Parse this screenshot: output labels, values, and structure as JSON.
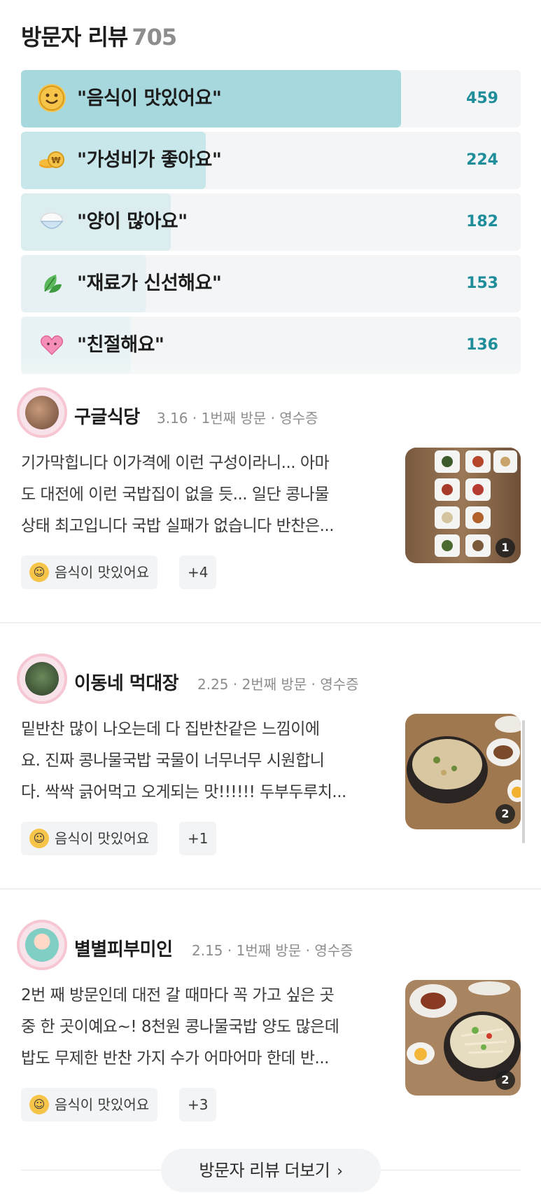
{
  "header": {
    "title": "방문자 리뷰",
    "count": "705"
  },
  "stats": [
    {
      "icon": "smiley-icon",
      "label": "\"음식이 맛있어요\"",
      "count": "459",
      "fraction": 0.76
    },
    {
      "icon": "coin-icon",
      "label": "\"가성비가 좋아요\"",
      "count": "224",
      "fraction": 0.37
    },
    {
      "icon": "rice-bowl-icon",
      "label": "\"양이 많아요\"",
      "count": "182",
      "fraction": 0.3
    },
    {
      "icon": "leaf-icon",
      "label": "\"재료가 신선해요\"",
      "count": "153",
      "fraction": 0.25
    },
    {
      "icon": "heart-icon",
      "label": "\"친절해요\"",
      "count": "136",
      "fraction": 0.22
    }
  ],
  "colors": {
    "accent": "#1f8d9a",
    "bar_fill": "#a6d8de"
  },
  "reviews": [
    {
      "name": "구글식당",
      "meta": "3.16 · 1번째 방문 · 영수증",
      "text_lines": [
        "기가막힙니다 이가격에 이런 구성이라니... 아마",
        "도 대전에 이런 국밥집이 없을 듯... 일단 콩나물",
        "상태 최고입니다 국밥 실패가 없습니다 반찬은..."
      ],
      "tag": "음식이 맛있어요",
      "extra": "+4",
      "photo_count": "1"
    },
    {
      "name": "이동네 먹대장",
      "meta": "2.25 · 2번째 방문 · 영수증",
      "text_lines": [
        "밑반찬 많이 나오는데 다 집반찬같은 느낌이에",
        "요. 진짜 콩나물국밥 국물이 너무너무 시원합니",
        "다. 싹싹 긁어먹고 오게되는 맛!!!!!! 두부두루치..."
      ],
      "tag": "음식이 맛있어요",
      "extra": "+1",
      "photo_count": "2"
    },
    {
      "name": "별별피부미인",
      "meta": "2.15 · 1번째 방문 · 영수증",
      "text_lines": [
        "2번 째 방문인데 대전 갈 때마다 꼭 가고 싶은 곳",
        "중 한 곳이예요~! 8천원 콩나물국밥 양도 많은데",
        "밥도 무제한 반찬 가지 수가 어마어마 한데 반..."
      ],
      "tag": "음식이 맛있어요",
      "extra": "+3",
      "photo_count": "2"
    }
  ],
  "more_button": {
    "label": "방문자 리뷰 더보기"
  }
}
